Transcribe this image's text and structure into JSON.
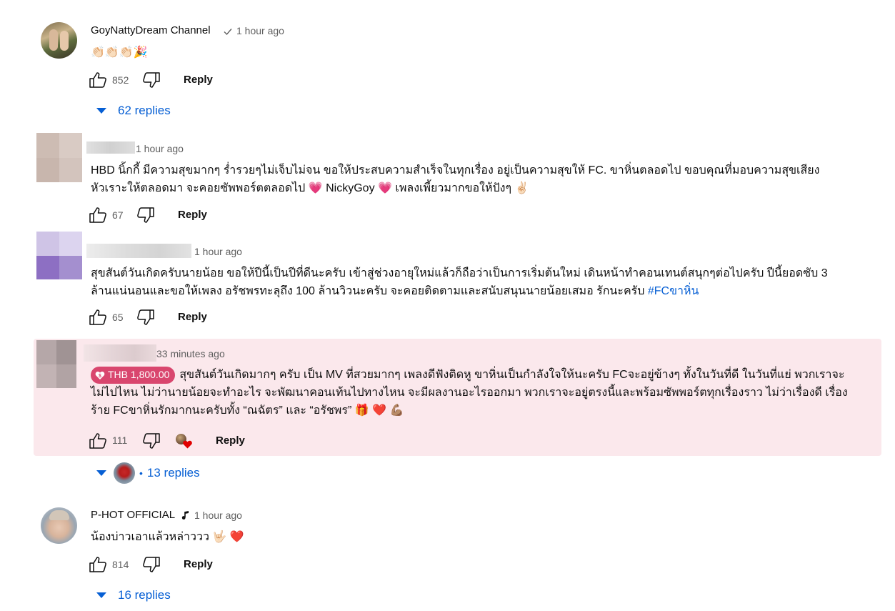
{
  "comments": [
    {
      "author": "GoyNattyDream Channel",
      "badge": "verified-check",
      "time": "1 hour ago",
      "text": "👏🏻👏🏻👏🏻🎉",
      "likes": "852",
      "reply_label": "Reply",
      "replies_label": "62 replies"
    },
    {
      "author": "",
      "time": "1 hour ago",
      "text": "HBD นิ้กกี้ มีความสุขมากๆ ร่ำรวยๆไม่เจ็บไม่จน  ขอให้ประสบความสำเร็จในทุกเรื่อง อยู่เป็นความสุขให้ FC. ขาหิ่นตลอดไป ขอบคุณที่มอบความสุขเสียงหัวเราะให้ตลอดมา จะคอยซัพพอร์ตตลอดไป  💗 NickyGoy 💗 เพลงเพี้ยวมากขอให้ปังๆ ✌🏻",
      "likes": "67",
      "reply_label": "Reply"
    },
    {
      "author": "",
      "time": "1 hour ago",
      "text": "สุขสันต์วันเกิดครับนายน้อย ขอให้ปีนี้เป็นปีที่ดีนะครับ เข้าสู่ช่วงอายุใหม่แล้วก็ถือว่าเป็นการเริ่มต้นใหม่ เดินหน้าทำคอนเทนต์สนุกๆต่อไปครับ ปีนี้ยอดซับ 3 ล้านแน่นอนและขอให้เพลง อรัชพรทะลุถึง 100 ล้านวิวนะครับ จะคอยติดตามและสนับสนุนนายน้อยเสมอ รักนะครับ ",
      "hashtag": "#FCขาหิ่น",
      "likes": "65",
      "reply_label": "Reply"
    },
    {
      "author": "",
      "time": "33 minutes ago",
      "superchat": "THB 1,800.00",
      "text": "สุขสันต์วันเกิดมากๆ ครับ เป็น MV ที่สวยมากๆ เพลงดีฟังติดหู ขาหิ่นเป็นกำลังใจให้นะครับ FCจะอยู่ข้างๆ ทั้งในวันที่ดี ในวันที่แย่ พวกเราจะไม่ไปไหน ไม่ว่านายน้อยจะทำอะไร จะพัฒนาคอนเท้นไปทางไหน จะมีผลงานอะไรออกมา พวกเราจะอยู่ตรงนี้และพร้อมซัพพอร์ตทุกเรื่องราว ไม่ว่าเรื่องดี เรื่องร้าย FCขาหิ่นรักมากนะครับทั้ง “ณฉัตร” และ “อรัชพร” 🎁 ❤️ 💪🏽",
      "likes": "111",
      "reply_label": "Reply",
      "replies_label": "13 replies"
    },
    {
      "author": "P-HOT OFFICIAL",
      "badge": "music-note",
      "time": "1 hour ago",
      "text": "น้องบ่าวเอาแล้วหล่าววว 🤟🏻 ❤️",
      "likes": "814",
      "reply_label": "Reply",
      "replies_label": "16 replies"
    }
  ],
  "colors": {
    "link_blue": "#065fd4",
    "highlight_bg": "#fbe8ec",
    "superchat": "#d9466e",
    "meta_gray": "#606060"
  }
}
